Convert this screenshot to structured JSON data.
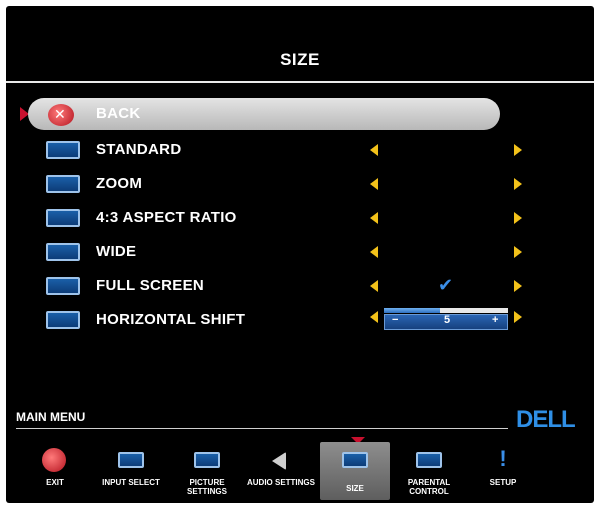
{
  "menu": {
    "title": "SIZE",
    "items": [
      {
        "label": "BACK",
        "icon": "back-icon",
        "selected": true
      },
      {
        "label": "STANDARD",
        "icon": "standard-icon",
        "arrows": true
      },
      {
        "label": "ZOOM",
        "icon": "zoom-icon",
        "arrows": true
      },
      {
        "label": "4:3 ASPECT RATIO",
        "icon": "aspect-ratio-icon",
        "arrows": true
      },
      {
        "label": "WIDE",
        "icon": "wide-icon",
        "arrows": true
      },
      {
        "label": "FULL SCREEN",
        "icon": "full-screen-icon",
        "arrows": true,
        "checked": true
      },
      {
        "label": "HORIZONTAL SHIFT",
        "icon": "horizontal-shift-icon",
        "arrows": true
      }
    ],
    "slider": {
      "minus": "−",
      "plus": "+",
      "value": "5",
      "fill_fraction": 0.45
    }
  },
  "footer": {
    "main_menu_label": "MAIN MENU",
    "brand": "DELL",
    "nav": [
      {
        "label": "EXIT",
        "icon": "exit-icon"
      },
      {
        "label": "INPUT SELECT",
        "icon": "input-select-icon"
      },
      {
        "label": "PICTURE SETTINGS",
        "icon": "picture-settings-icon"
      },
      {
        "label": "AUDIO SETTINGS",
        "icon": "audio-settings-icon"
      },
      {
        "label": "SIZE",
        "icon": "size-icon",
        "selected": true
      },
      {
        "label": "PARENTAL CONTROL",
        "icon": "parental-control-icon"
      },
      {
        "label": "SETUP",
        "icon": "setup-icon"
      }
    ]
  },
  "colors": {
    "background": "#000000",
    "text": "#ffffff",
    "arrow": "#f3c21a",
    "accent_blue": "#2f8fe6",
    "highlight": "#c8c8c8",
    "pointer_red": "#c8102e"
  }
}
